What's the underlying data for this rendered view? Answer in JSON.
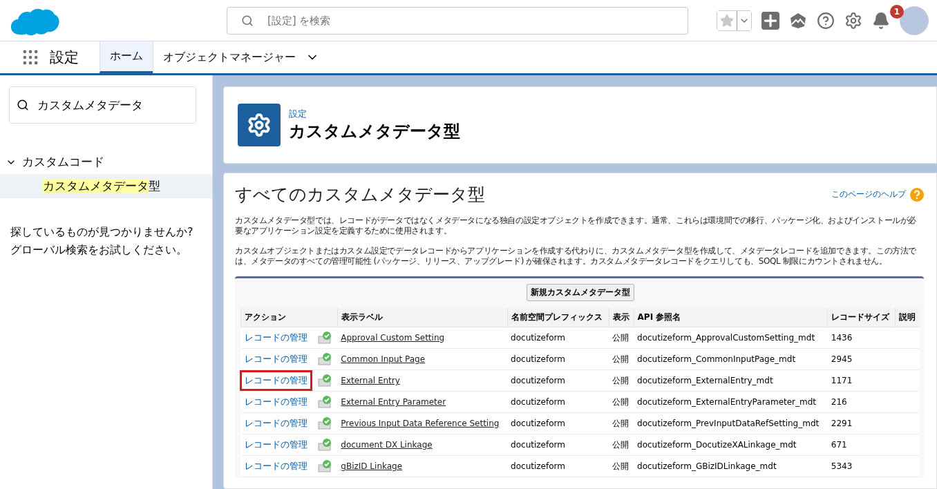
{
  "header": {
    "search": {
      "placeholder": "[設定] を検索"
    },
    "notification_count": "1"
  },
  "nav": {
    "app_name": "設定",
    "tabs": [
      {
        "label": "ホーム",
        "selected": true,
        "has_menu": false
      },
      {
        "label": "オブジェクトマネージャー",
        "selected": false,
        "has_menu": true
      }
    ]
  },
  "sidebar": {
    "search": {
      "value": "カスタムメタデータ"
    },
    "tree": [
      {
        "label": "カスタムコード",
        "expanded": true,
        "children": [
          {
            "label": "カスタムメタデータ型",
            "selected": true
          }
        ]
      }
    ],
    "hint": "探しているものが見つかりませんか?\nグローバル検索をお試しください。"
  },
  "page_header": {
    "breadcrumb": "設定",
    "title": "カスタムメタデータ型"
  },
  "content": {
    "title": "すべてのカスタムメタデータ型",
    "help_link": "このページのヘルプ",
    "paragraphs": [
      "カスタムメタデータ型では、レコードがデータではなくメタデータになる独自の設定オブジェクトを作成できます。通常、これらは環境間での移行、パッケージ化、およびインストールが必要なアプリケーション設定を定義するために使用されます。",
      "カスタムオブジェクトまたはカスタム設定でデータレコードからアプリケーションを作成する代わりに、カスタムメタデータ型を作成して、メタデータレコードを追加できます。この方法では、メタデータのすべての管理可能性 (パッケージ、リリース、アップグレード) が確保されます。カスタムメタデータレコードをクエリしても、SOQL 制限にカウントされません。"
    ],
    "new_button": "新規カスタムメタデータ型",
    "table": {
      "columns": [
        "アクション",
        "表示ラベル",
        "名前空間プレフィックス",
        "表示",
        "API 参照名",
        "レコードサイズ",
        "説明"
      ],
      "rows": [
        {
          "action": "レコードの管理",
          "highlighted": false,
          "label": "Approval Custom Setting",
          "namespace": "docutizeform",
          "visibility": "公開",
          "api_name": "docutizeform_ApprovalCustomSetting_mdt",
          "size": "1436"
        },
        {
          "action": "レコードの管理",
          "highlighted": false,
          "label": "Common Input Page",
          "namespace": "docutizeform",
          "visibility": "公開",
          "api_name": "docutizeform_CommonInputPage_mdt",
          "size": "2945"
        },
        {
          "action": "レコードの管理",
          "highlighted": true,
          "label": "External Entry",
          "namespace": "docutizeform",
          "visibility": "公開",
          "api_name": "docutizeform_ExternalEntry_mdt",
          "size": "1171"
        },
        {
          "action": "レコードの管理",
          "highlighted": false,
          "label": "External Entry Parameter",
          "namespace": "docutizeform",
          "visibility": "公開",
          "api_name": "docutizeform_ExternalEntryParameter_mdt",
          "size": "216"
        },
        {
          "action": "レコードの管理",
          "highlighted": false,
          "label": "Previous Input Data Reference Setting",
          "namespace": "docutizeform",
          "visibility": "公開",
          "api_name": "docutizeform_PrevInputDataRefSetting_mdt",
          "size": "2291"
        },
        {
          "action": "レコードの管理",
          "highlighted": false,
          "label": "document DX Linkage",
          "namespace": "docutizeform",
          "visibility": "公開",
          "api_name": "docutizeform_DocutizeXALinkage_mdt",
          "size": "671"
        },
        {
          "action": "レコードの管理",
          "highlighted": false,
          "label": "gBizID Linkage",
          "namespace": "docutizeform",
          "visibility": "公開",
          "api_name": "docutizeform_GBizIDLinkage_mdt",
          "size": "5343"
        }
      ]
    }
  }
}
